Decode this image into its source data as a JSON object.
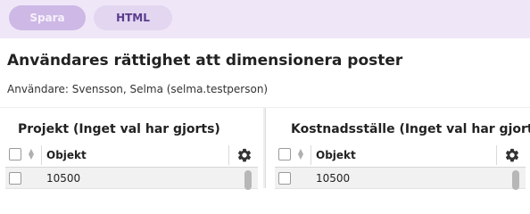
{
  "toolbar": {
    "save_label": "Spara",
    "html_label": "HTML"
  },
  "header": {
    "title": "Användares rättighet att dimensionera poster",
    "user_line": "Användare: Svensson, Selma (selma.testperson)"
  },
  "panels": [
    {
      "title": "Projekt (Inget val har gjorts)",
      "column": "Objekt",
      "rows": [
        {
          "value": "10500"
        }
      ]
    },
    {
      "title": "Kostnadsställe (Inget val har gjorts)",
      "column": "Objekt",
      "rows": [
        {
          "value": "10500"
        }
      ]
    }
  ],
  "colors": {
    "toolbar_bg": "#efe7f7",
    "save_button": "#cdb8e6",
    "html_button": "#e2d6f0",
    "html_text": "#5a3c8e"
  },
  "icons": {
    "settings": "gear-icon",
    "sort": "sort-icon"
  }
}
